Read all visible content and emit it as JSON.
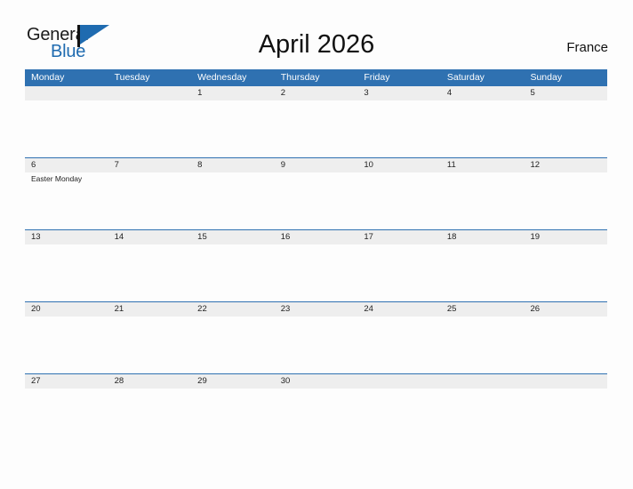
{
  "brand": {
    "name_part1": "General",
    "name_part2": "Blue",
    "flag_icon": "flag-triangle-icon",
    "accent_color": "#1f6bb0"
  },
  "header": {
    "title": "April 2026",
    "country": "France"
  },
  "colors": {
    "header_blue": "#2f71b1",
    "day_band_gray": "#eeeeee",
    "page_background": "#fdfdfd",
    "text": "#222222"
  },
  "calendar": {
    "month": "April",
    "year": "2026",
    "weekday_headers": [
      "Monday",
      "Tuesday",
      "Wednesday",
      "Thursday",
      "Friday",
      "Saturday",
      "Sunday"
    ],
    "weeks": [
      [
        {
          "day": "",
          "events": []
        },
        {
          "day": "",
          "events": []
        },
        {
          "day": "1",
          "events": []
        },
        {
          "day": "2",
          "events": []
        },
        {
          "day": "3",
          "events": []
        },
        {
          "day": "4",
          "events": []
        },
        {
          "day": "5",
          "events": []
        }
      ],
      [
        {
          "day": "6",
          "events": [
            "Easter Monday"
          ]
        },
        {
          "day": "7",
          "events": []
        },
        {
          "day": "8",
          "events": []
        },
        {
          "day": "9",
          "events": []
        },
        {
          "day": "10",
          "events": []
        },
        {
          "day": "11",
          "events": []
        },
        {
          "day": "12",
          "events": []
        }
      ],
      [
        {
          "day": "13",
          "events": []
        },
        {
          "day": "14",
          "events": []
        },
        {
          "day": "15",
          "events": []
        },
        {
          "day": "16",
          "events": []
        },
        {
          "day": "17",
          "events": []
        },
        {
          "day": "18",
          "events": []
        },
        {
          "day": "19",
          "events": []
        }
      ],
      [
        {
          "day": "20",
          "events": []
        },
        {
          "day": "21",
          "events": []
        },
        {
          "day": "22",
          "events": []
        },
        {
          "day": "23",
          "events": []
        },
        {
          "day": "24",
          "events": []
        },
        {
          "day": "25",
          "events": []
        },
        {
          "day": "26",
          "events": []
        }
      ],
      [
        {
          "day": "27",
          "events": []
        },
        {
          "day": "28",
          "events": []
        },
        {
          "day": "29",
          "events": []
        },
        {
          "day": "30",
          "events": []
        },
        {
          "day": "",
          "events": []
        },
        {
          "day": "",
          "events": []
        },
        {
          "day": "",
          "events": []
        }
      ]
    ]
  }
}
